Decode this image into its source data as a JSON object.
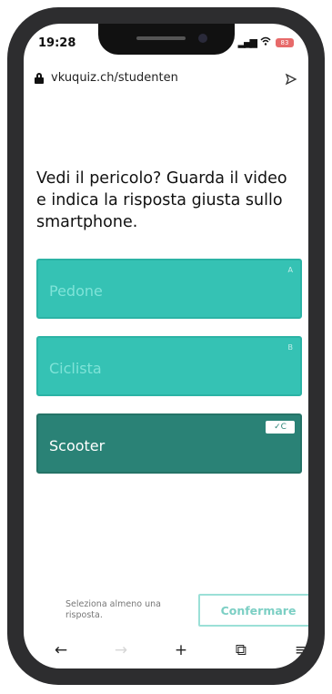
{
  "status_bar": {
    "time": "19:28",
    "signal": "ᵢll",
    "wifi": "wifi-icon",
    "battery_label": "83"
  },
  "browser": {
    "url": "vkuquiz.ch/studenten",
    "lock_icon": "lock-icon",
    "share_icon": "share-icon"
  },
  "quiz": {
    "question": "Vedi il pericolo? Guarda il video e indica la risposta giusta sullo smartphone.",
    "options": [
      {
        "label": "Pedone",
        "key": "A",
        "selected": false
      },
      {
        "label": "Ciclista",
        "key": "B",
        "selected": false
      },
      {
        "label": "Scooter",
        "key": "C",
        "selected": true
      }
    ],
    "selected_badge": "✓C"
  },
  "footer": {
    "hint": "Seleziona almeno una risposta.",
    "confirm_label": "Confermare"
  },
  "toolbar": {
    "back": "←",
    "forward": "→",
    "new_tab": "+",
    "tabs": "⧉",
    "menu": "≡"
  },
  "colors": {
    "option_idle": "#35c2b4",
    "option_selected": "#2a8276",
    "confirm_border": "#9be0d7"
  }
}
